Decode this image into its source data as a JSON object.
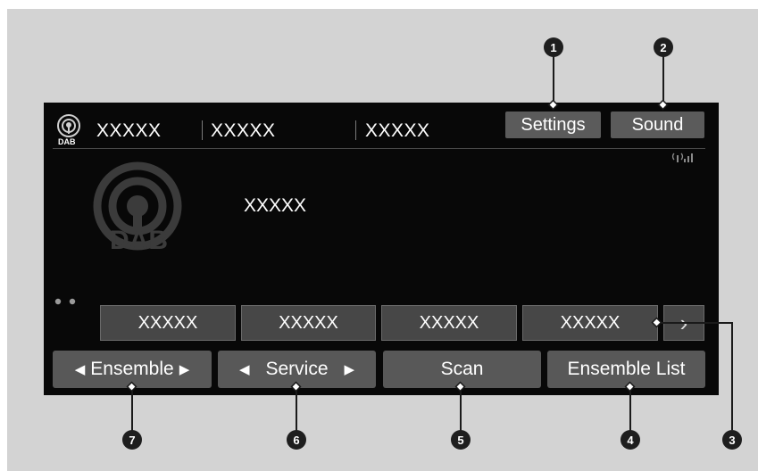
{
  "header": {
    "source_icon": "dab-radio-icon",
    "source_icon_label": "DAB",
    "field1": "XXXXX",
    "field2": "XXXXX",
    "field3": "XXXXX",
    "settings_label": "Settings",
    "sound_label": "Sound",
    "signal_icon": "signal-strength-icon"
  },
  "main": {
    "logo_label": "DAB",
    "station_text": "XXXXX",
    "page_indicator_icon": "page-dots-icon"
  },
  "presets": [
    {
      "label": "XXXXX"
    },
    {
      "label": "XXXXX"
    },
    {
      "label": "XXXXX"
    },
    {
      "label": "XXXXX"
    }
  ],
  "presets_next_icon": "chevron-right-icon",
  "bottom": {
    "ensemble_label": "Ensemble",
    "service_label": "Service",
    "scan_label": "Scan",
    "ensemble_list_label": "Ensemble List"
  },
  "callouts": [
    "1",
    "2",
    "3",
    "4",
    "5",
    "6",
    "7"
  ],
  "colors": {
    "frame_bg": "#d3d3d3",
    "screen_bg": "#080808",
    "button_bg": "#585858",
    "preset_bg": "#474747",
    "callout_bg": "#1e1e1e"
  }
}
